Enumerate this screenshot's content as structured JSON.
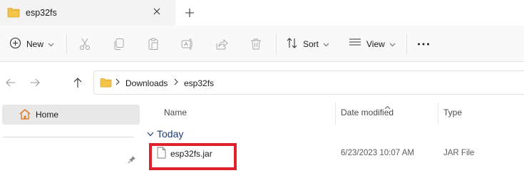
{
  "window": {
    "tab_title": "esp32fs",
    "icons": {
      "tab": "folder-icon",
      "close": "close-icon",
      "new_tab": "plus-icon"
    }
  },
  "toolbar": {
    "new_label": "New",
    "sort_label": "Sort",
    "view_label": "View",
    "icons": [
      "new-plus-icon",
      "cut-icon",
      "copy-icon",
      "paste-icon",
      "rename-icon",
      "share-icon",
      "delete-icon",
      "sort-icon",
      "view-icon",
      "more-icon"
    ]
  },
  "address_bar": {
    "crumbs": [
      "Downloads",
      "esp32fs"
    ],
    "icons": {
      "back": "back-arrow-icon",
      "forward": "forward-arrow-icon",
      "up": "up-arrow-icon",
      "folder": "folder-icon"
    }
  },
  "sidebar": {
    "items": [
      {
        "label": "Home",
        "icon": "home-icon",
        "selected": true
      }
    ]
  },
  "file_list": {
    "columns": [
      "Name",
      "Date modified",
      "Type"
    ],
    "sort_column": "Date modified",
    "groups": [
      {
        "label": "Today",
        "rows": [
          {
            "name": "esp32fs.jar",
            "date": "6/23/2023 10:07 AM",
            "type": "JAR File",
            "icon": "file-icon"
          }
        ]
      }
    ]
  },
  "annotation": {
    "highlight_color": "#e0202b"
  },
  "colors": {
    "accent": "#0067c0",
    "group_header": "#1e3a78",
    "folder": "#f4c54a"
  }
}
